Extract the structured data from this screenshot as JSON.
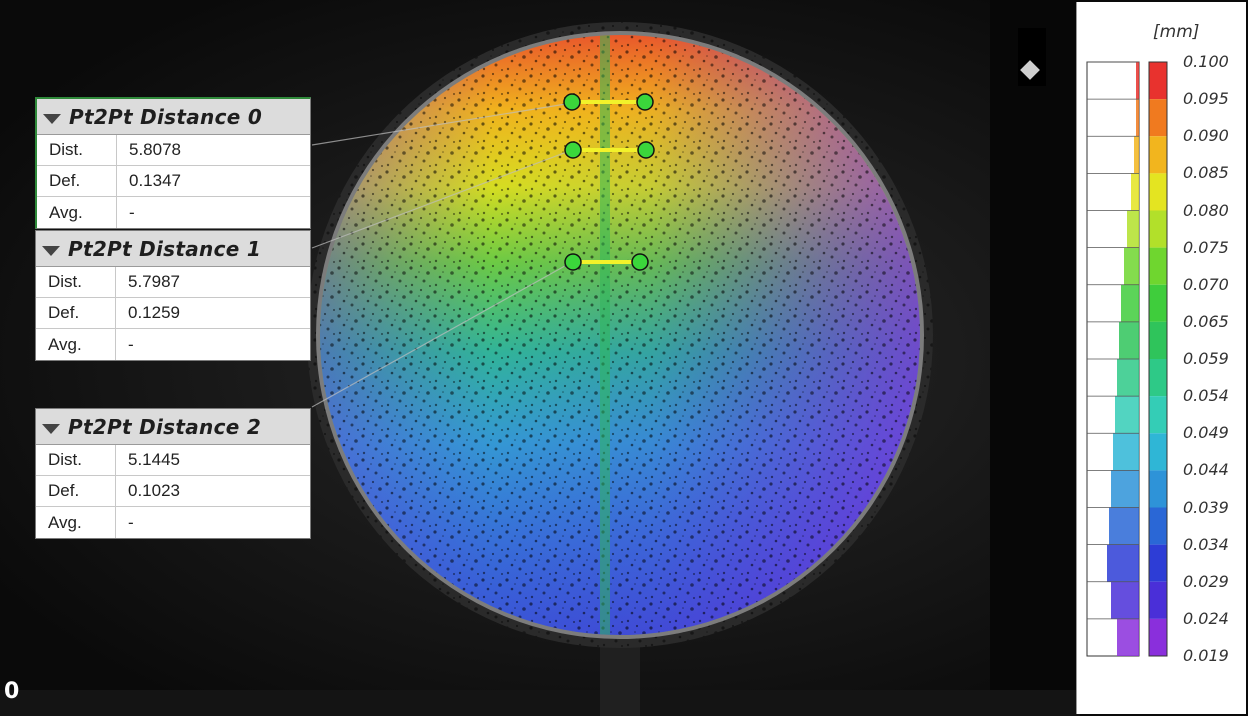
{
  "points": [
    {
      "title": "Pt2Pt Distance 0",
      "rows": [
        {
          "label": "Dist.",
          "value": "5.8078"
        },
        {
          "label": "Def.",
          "value": "0.1347"
        },
        {
          "label": "Avg.",
          "value": "-"
        }
      ]
    },
    {
      "title": "Pt2Pt Distance 1",
      "rows": [
        {
          "label": "Dist.",
          "value": "5.7987"
        },
        {
          "label": "Def.",
          "value": "0.1259"
        },
        {
          "label": "Avg.",
          "value": "-"
        }
      ]
    },
    {
      "title": "Pt2Pt Distance 2",
      "rows": [
        {
          "label": "Dist.",
          "value": "5.1445"
        },
        {
          "label": "Def.",
          "value": "0.1023"
        },
        {
          "label": "Avg.",
          "value": "-"
        }
      ]
    }
  ],
  "legend": {
    "unit": "[mm]",
    "ticks": [
      "0.100",
      "0.095",
      "0.090",
      "0.085",
      "0.080",
      "0.075",
      "0.070",
      "0.065",
      "0.059",
      "0.054",
      "0.049",
      "0.044",
      "0.039",
      "0.034",
      "0.029",
      "0.024",
      "0.019"
    ],
    "colors": [
      "#e8322e",
      "#f07a1f",
      "#f2b51e",
      "#e4e421",
      "#b2e02a",
      "#6fd62f",
      "#3fcd3c",
      "#2fc45b",
      "#2ec987",
      "#34cdb6",
      "#2fb6d6",
      "#2e93d8",
      "#2a67d6",
      "#2d3dd6",
      "#4a2fd8",
      "#8a2fdc",
      "#c42fe0"
    ]
  },
  "overlay": {
    "icon": "diamond-icon"
  },
  "frame": {
    "number": "0"
  }
}
